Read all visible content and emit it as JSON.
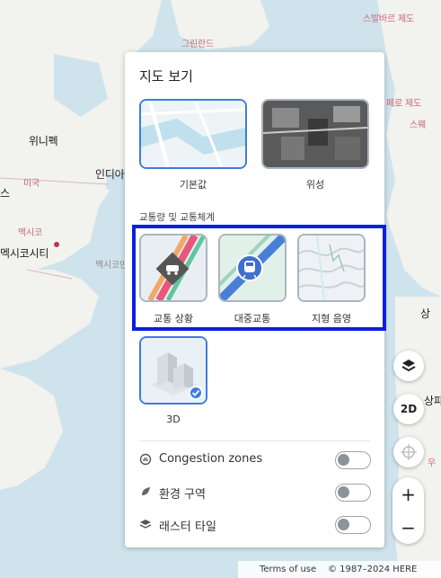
{
  "map_labels": {
    "greenland": "그린란드",
    "svalbard": "스발바르 제도",
    "winnipeg": "위니펙",
    "indianapolis": "인디아",
    "usa": "미국",
    "s_left": "스",
    "mexico": "멕시코",
    "mexico_city": "멕시코시티",
    "guatemala": "멕시코만",
    "faroe": "페로 제도",
    "sweden": "스웨",
    "sanpa": "상파",
    "sang": "상",
    "u": "우"
  },
  "panel": {
    "title": "지도 보기",
    "base_tiles": [
      {
        "label": "기본값",
        "icon": "default-map",
        "selected": true
      },
      {
        "label": "위성",
        "icon": "satellite-map",
        "selected": false
      }
    ],
    "section_label": "교통량 및 교통체계",
    "traffic_tiles": [
      {
        "label": "교통 상황",
        "icon": "traffic-car-icon"
      },
      {
        "label": "대중교통",
        "icon": "transit-train-icon"
      },
      {
        "label": "지형 음영",
        "icon": "terrain-icon"
      }
    ],
    "three_d": {
      "label": "3D",
      "selected": true
    },
    "toggles": [
      {
        "label": "Congestion zones",
        "icon": "congestion-icon",
        "on": false
      },
      {
        "label": "환경 구역",
        "icon": "leaf-icon",
        "on": false
      },
      {
        "label": "래스터 타일",
        "icon": "layers-icon",
        "on": false
      }
    ]
  },
  "controls": {
    "layers_icon": "layers-icon",
    "mode_label": "2D",
    "compass_icon": "compass-icon",
    "zoom_in": "+",
    "zoom_out": "−"
  },
  "footer": {
    "terms": "Terms of use",
    "copyright": "© 1987–2024 HERE"
  },
  "colors": {
    "accent": "#3f7be0",
    "highlight": "#0a1fe0",
    "water": "#cfe3ec",
    "land": "#f4f4f1"
  }
}
